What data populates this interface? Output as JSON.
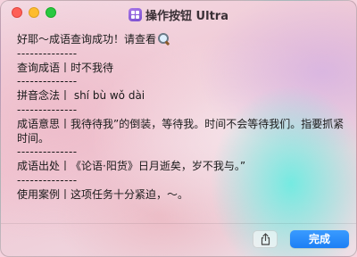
{
  "window": {
    "title": "操作按钮 Ultra"
  },
  "content": {
    "intro": "好耶～成语查询成功！请查看",
    "separator": "--------------",
    "query_line": "查询成语丨时不我待",
    "pinyin_line": "拼音念法丨 shí bù wǒ dài",
    "meaning_line": "成语意思丨我待待我”的倒装，等待我。时间不会等待我们。指要抓紧时间。",
    "source_line": "成语出处丨《论语·阳货》日月逝矣，岁不我与。”",
    "example_line": "使用案例丨这项任务十分紧迫，～。"
  },
  "footer": {
    "done_label": "完成",
    "share_icon": "share-icon"
  },
  "colors": {
    "accent": "#1c7ff5",
    "close": "#fe5f57",
    "minimize": "#febc2e",
    "maximize": "#28c840"
  }
}
